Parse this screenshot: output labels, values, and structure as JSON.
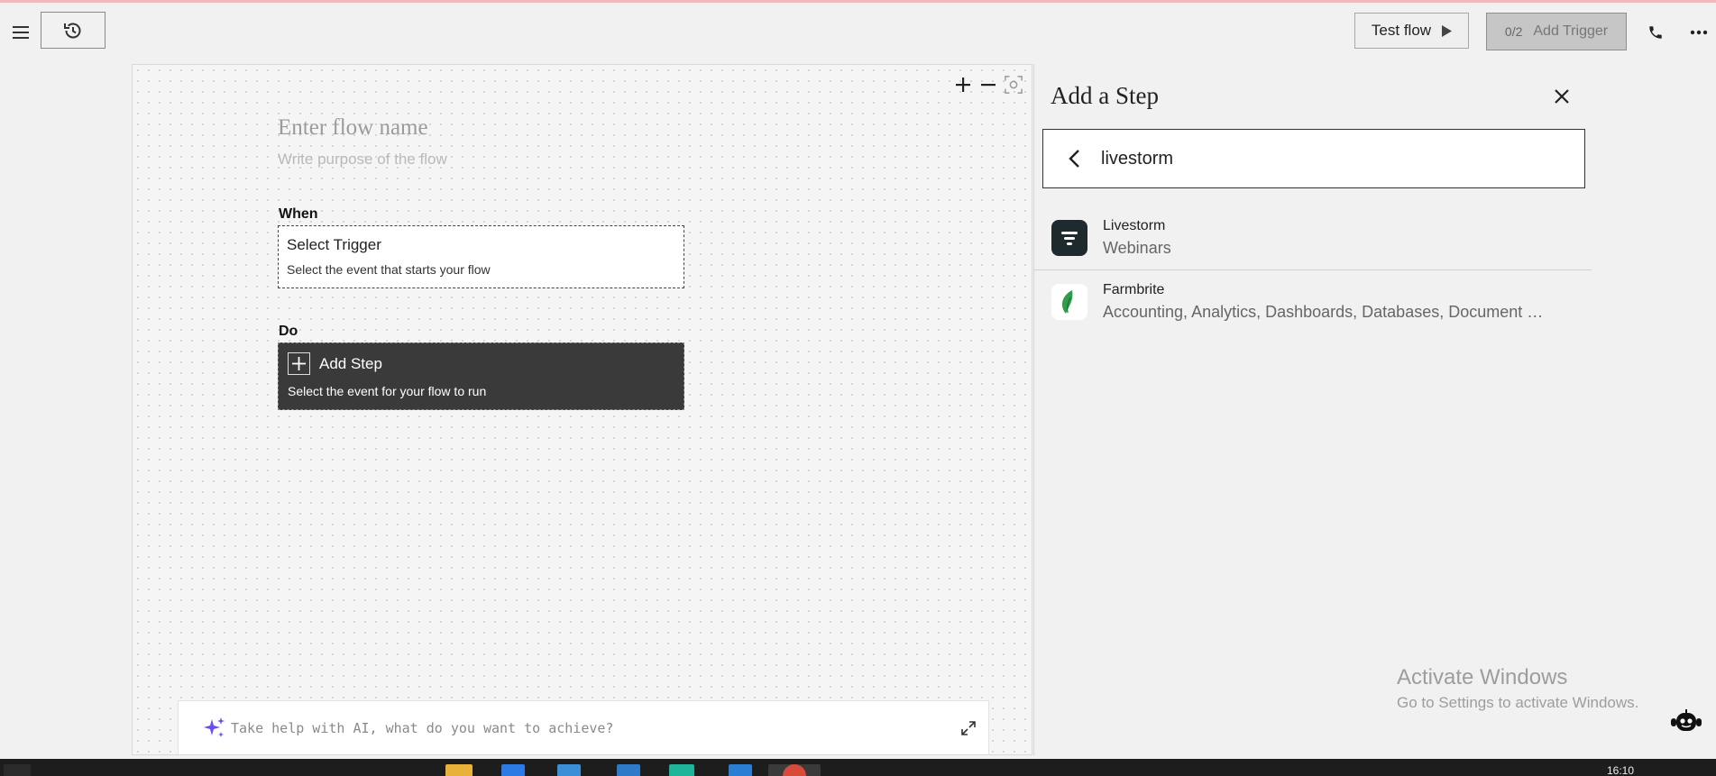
{
  "topbar": {
    "test_flow_label": "Test flow",
    "trigger_count": "0/2",
    "add_trigger_label": "Add Trigger"
  },
  "canvas": {
    "flow_name_placeholder": "Enter flow name",
    "flow_purpose_placeholder": "Write purpose of the flow",
    "when_label": "When",
    "trigger_title": "Select Trigger",
    "trigger_subtitle": "Select the event that starts your flow",
    "do_label": "Do",
    "step_title": "Add Step",
    "step_subtitle": "Select the event for your flow to run",
    "ai_placeholder": "Take help with AI, what do you want to achieve?"
  },
  "panel": {
    "title": "Add a Step",
    "search_value": "livestorm",
    "results": [
      {
        "name": "Livestorm",
        "categories": "Webinars"
      },
      {
        "name": "Farmbrite",
        "categories": "Accounting, Analytics, Dashboards, Databases, Document Management"
      }
    ]
  },
  "watermark": {
    "line1": "Activate Windows",
    "line2": "Go to Settings to activate Windows."
  },
  "taskbar": {
    "clock": "16:10"
  },
  "icons": {
    "menu": "hamburger-icon",
    "history": "history-icon",
    "play": "play-icon",
    "phone": "phone-icon",
    "more": "more-horizontal-icon",
    "zoom_in": "plus-icon",
    "zoom_out": "minus-icon",
    "fit": "fit-screen-icon",
    "close": "close-icon",
    "back": "chevron-left-icon",
    "sparkle": "sparkle-icon",
    "expand": "expand-icon",
    "bot": "bot-icon"
  },
  "colors": {
    "top_accent": "#f2b8bd",
    "step_card_bg": "#3a3a3a",
    "livestorm_logo": "#1f2a2e",
    "farmbrite_leaf": "#2e9e4b",
    "ai_sparkle": "#6a4cf0"
  }
}
